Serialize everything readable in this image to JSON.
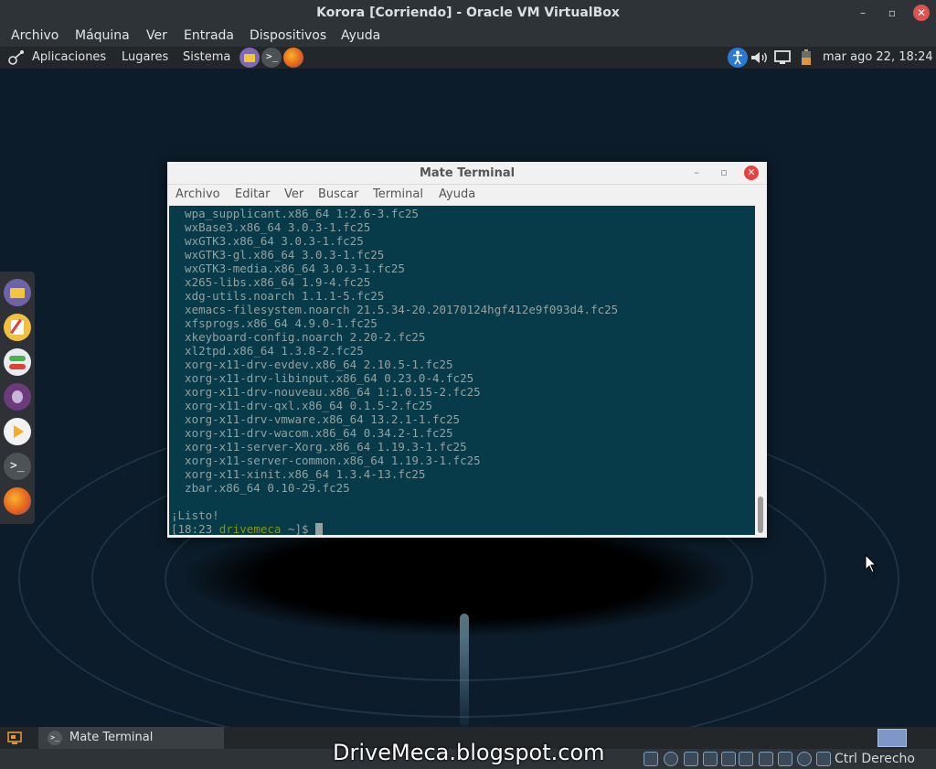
{
  "window": {
    "title": "Korora [Corriendo] - Oracle VM VirtualBox",
    "minimize_glyph": "–",
    "maximize_glyph": "▫",
    "close_glyph": "✕"
  },
  "vb_menu": [
    "Archivo",
    "Máquina",
    "Ver",
    "Entrada",
    "Dispositivos",
    "Ayuda"
  ],
  "top_panel": {
    "menus": [
      "Aplicaciones",
      "Lugares",
      "Sistema"
    ],
    "clock": "mar ago 22, 18:24"
  },
  "terminal": {
    "title": "Mate Terminal",
    "minimize_glyph": "–",
    "maximize_glyph": "▫",
    "close_glyph": "✕",
    "menu": [
      "Archivo",
      "Editar",
      "Ver",
      "Buscar",
      "Terminal",
      "Ayuda"
    ],
    "lines": [
      "  wpa_supplicant.x86_64 1:2.6-3.fc25",
      "  wxBase3.x86_64 3.0.3-1.fc25",
      "  wxGTK3.x86_64 3.0.3-1.fc25",
      "  wxGTK3-gl.x86_64 3.0.3-1.fc25",
      "  wxGTK3-media.x86_64 3.0.3-1.fc25",
      "  x265-libs.x86_64 1.9-4.fc25",
      "  xdg-utils.noarch 1.1.1-5.fc25",
      "  xemacs-filesystem.noarch 21.5.34-20.20170124hgf412e9f093d4.fc25",
      "  xfsprogs.x86_64 4.9.0-1.fc25",
      "  xkeyboard-config.noarch 2.20-2.fc25",
      "  xl2tpd.x86_64 1.3.8-2.fc25",
      "  xorg-x11-drv-evdev.x86_64 2.10.5-1.fc25",
      "  xorg-x11-drv-libinput.x86_64 0.23.0-4.fc25",
      "  xorg-x11-drv-nouveau.x86_64 1:1.0.15-2.fc25",
      "  xorg-x11-drv-qxl.x86_64 0.1.5-2.fc25",
      "  xorg-x11-drv-vmware.x86_64 13.2.1-1.fc25",
      "  xorg-x11-drv-wacom.x86_64 0.34.2-1.fc25",
      "  xorg-x11-server-Xorg.x86_64 1.19.3-1.fc25",
      "  xorg-x11-server-common.x86_64 1.19.3-1.fc25",
      "  xorg-x11-xinit.x86_64 1.3.4-13.fc25",
      "  zbar.x86_64 0.10-29.fc25",
      "",
      "¡Listo!"
    ],
    "prompt": {
      "open": "[18:23 ",
      "user": "drivemeca",
      "path": " ~]$ "
    }
  },
  "taskbar": {
    "item_label": "Mate Terminal"
  },
  "status_bar": {
    "host_key": "Ctrl Derecho",
    "watermark": "DriveMeca.blogspot.com"
  },
  "colors": {
    "terminal_bg": "#073b49",
    "terminal_fg": "#93a1a1",
    "prompt_user": "#859900",
    "close_red": "#e8403c"
  }
}
